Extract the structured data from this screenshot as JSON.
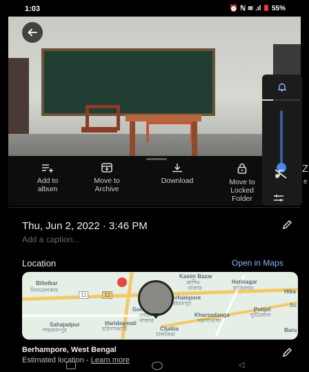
{
  "status": {
    "time": "1:03",
    "icons": "⏰ ℕ ≋ .ıl",
    "battery": "55%"
  },
  "actions": [
    {
      "label": "Add to\nalbum",
      "icon": "playlist-add-icon"
    },
    {
      "label": "Move to\nArchive",
      "icon": "archive-icon"
    },
    {
      "label": "Download",
      "icon": "download-icon"
    },
    {
      "label": "Move to\nLocked\nFolder",
      "icon": "lock-icon"
    }
  ],
  "details": {
    "date": "Thu, Jun 2, 2022 · 3:46 PM",
    "caption_placeholder": "Add a caption..."
  },
  "location": {
    "heading": "Location",
    "open_maps": "Open in Maps",
    "place": "Berhampore, West Bengal",
    "estimate": "Estimated location - ",
    "learn_more": "Learn more"
  },
  "map": {
    "labels": [
      "Biltelkar",
      "বিলতেলকার",
      "Kasim Bazar",
      "কাশিম",
      "বাজার",
      "Hatinagar",
      "হাতিনগর",
      "Berhampore",
      "বহরমপুর",
      "Gora Bazar",
      "গোরা",
      "বাজার",
      "Hika",
      "Bo",
      "Putijol",
      "পুটিজোল",
      "Kharsadanga",
      "খড়সাডাঙ্গা",
      "Sahajadpur",
      "শাহজাদপুর",
      "Haridasmati",
      "হরিদাসমাটি",
      "Chaltia",
      "চালতিয়া",
      "Baru",
      "11",
      "12"
    ]
  },
  "overlay": {
    "side_letter": "Z",
    "side_letter2": "e"
  },
  "colors": {
    "accent": "#8ab4f8",
    "background": "#000000",
    "volume": "#4a86e8"
  }
}
